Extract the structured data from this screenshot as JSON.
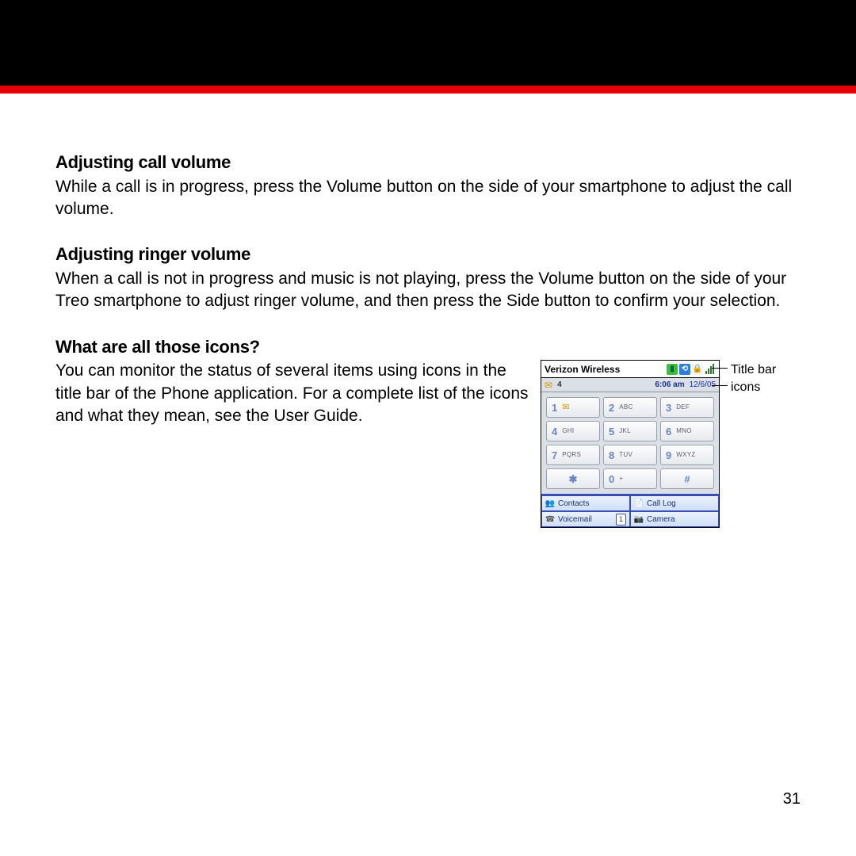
{
  "page_number": "31",
  "sections": {
    "s1_title": "Adjusting call volume",
    "s1_body": "While a call is in progress, press the Volume button on the side of your smartphone to adjust the call volume.",
    "s2_title": "Adjusting ringer volume",
    "s2_body": "When a call is not in progress and music is not playing, press the Volume button on the side of your Treo smartphone to adjust ringer volume, and then press the Side button to confirm your selection.",
    "s3_title": "What are all those icons?",
    "s3_body": "You can monitor the status of several items using icons in the title bar of the Phone application. For a complete list of the icons and what they mean, see the User Guide."
  },
  "phone": {
    "carrier": "Verizon Wireless",
    "msg_count": "4",
    "time": "6:06 am",
    "date": "12/6/05",
    "keys": {
      "k1_num": "1",
      "k1_lab": "",
      "k1_glyph": "✉",
      "k2_num": "2",
      "k2_lab": "ABC",
      "k3_num": "3",
      "k3_lab": "DEF",
      "k4_num": "4",
      "k4_lab": "GHI",
      "k5_num": "5",
      "k5_lab": "JKL",
      "k6_num": "6",
      "k6_lab": "MNO",
      "k7_num": "7",
      "k7_lab": "PQRS",
      "k8_num": "8",
      "k8_lab": "TUV",
      "k9_num": "9",
      "k9_lab": "WXYZ",
      "kstar": "✱",
      "k0_num": "0",
      "k0_lab": "+",
      "khash": "#"
    },
    "favs": {
      "contacts": "Contacts",
      "calllog": "Call Log",
      "voicemail": "Voicemail",
      "vm_badge": "1",
      "camera": "Camera"
    }
  },
  "callouts": {
    "title_bar": "Title bar",
    "icons": "icons"
  }
}
